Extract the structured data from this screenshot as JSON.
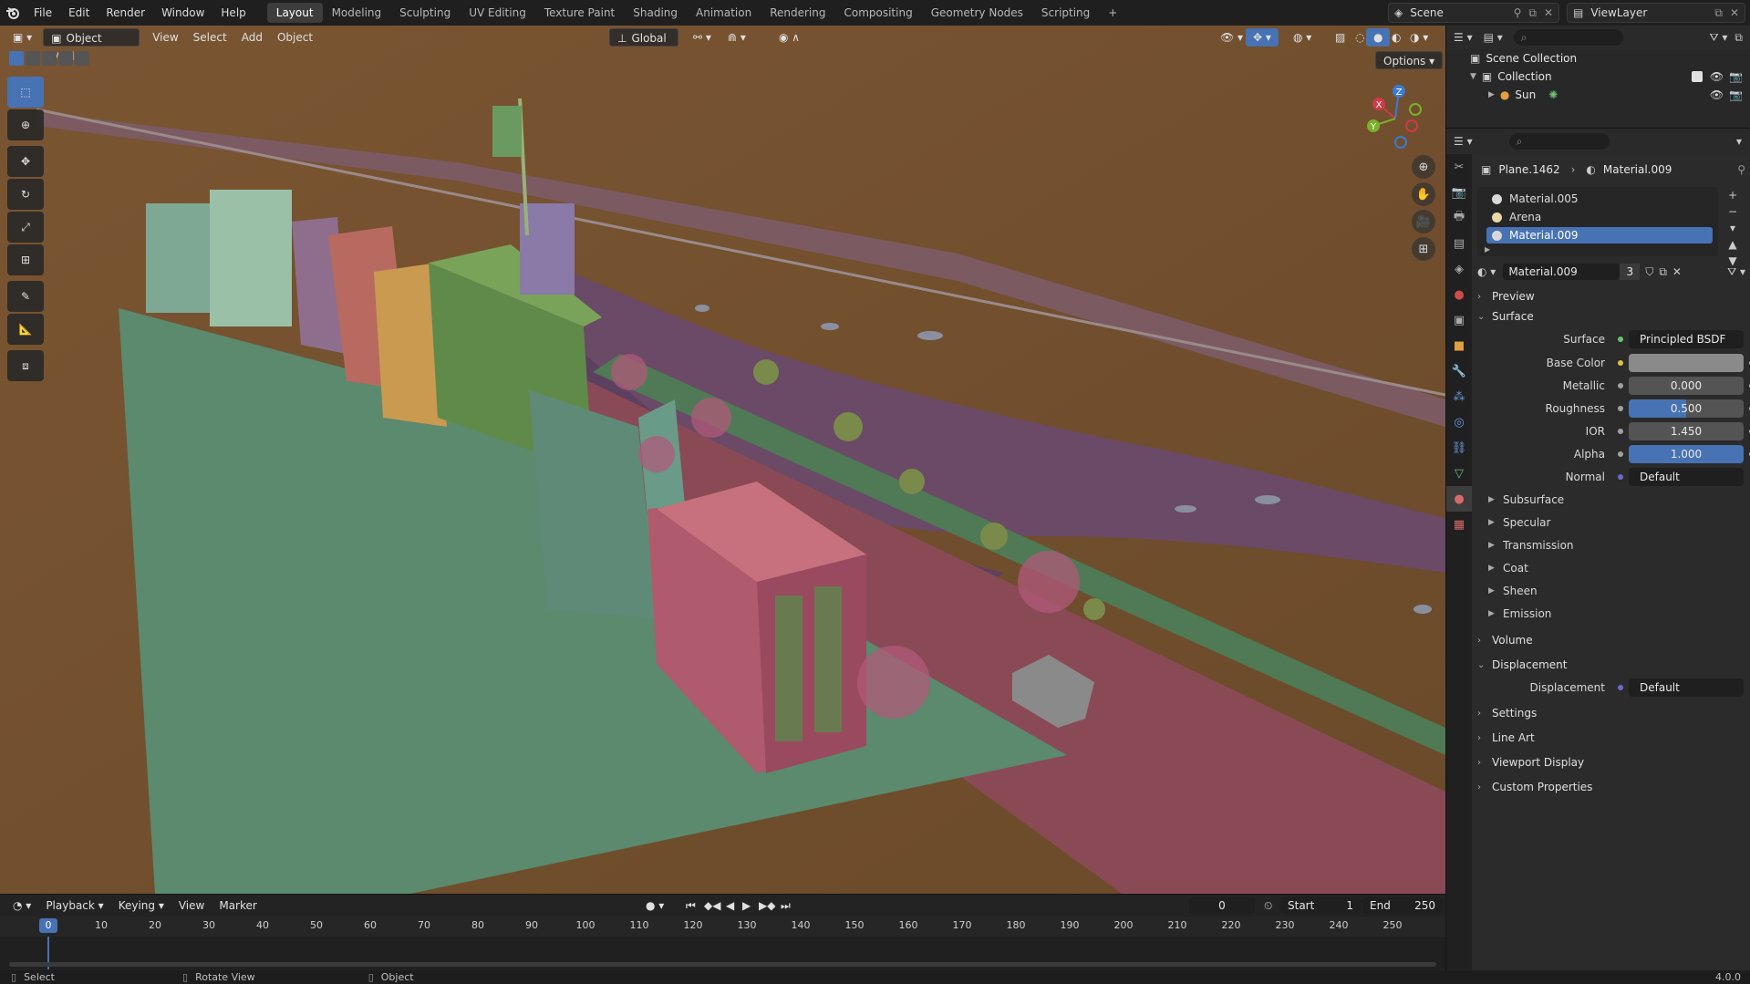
{
  "menubar": {
    "items": [
      "File",
      "Edit",
      "Render",
      "Window",
      "Help"
    ],
    "workspaces": [
      "Layout",
      "Modeling",
      "Sculpting",
      "UV Editing",
      "Texture Paint",
      "Shading",
      "Animation",
      "Rendering",
      "Compositing",
      "Geometry Nodes",
      "Scripting"
    ],
    "active_workspace": "Layout",
    "add_tab": "+",
    "scene": "Scene",
    "view_layer": "ViewLayer"
  },
  "viewport": {
    "mode": "Object Mode",
    "menus": [
      "View",
      "Select",
      "Add",
      "Object"
    ],
    "transform_orientation": "Global",
    "options_label": "Options",
    "gizmo": {
      "x": "X",
      "y": "Y",
      "z": "Z"
    }
  },
  "timeline": {
    "menus": [
      "Playback",
      "Keying",
      "View",
      "Marker"
    ],
    "current_frame": "0",
    "start_label": "Start",
    "start": "1",
    "end_label": "End",
    "end": "250",
    "ticks": [
      "10",
      "20",
      "30",
      "40",
      "50",
      "60",
      "70",
      "80",
      "90",
      "100",
      "110",
      "120",
      "130",
      "140",
      "150",
      "160",
      "170",
      "180",
      "190",
      "200",
      "210",
      "220",
      "230",
      "240",
      "250"
    ],
    "playhead_label": "0"
  },
  "statusbar": {
    "select": "Select",
    "rotate": "Rotate View",
    "object": "Object",
    "version": "4.0.0"
  },
  "outliner": {
    "scene_collection": "Scene Collection",
    "collection": "Collection",
    "sun": "Sun"
  },
  "properties": {
    "object": "Plane.1462",
    "material": "Material.009",
    "slots": [
      "Material.005",
      "Arena",
      "Material.009"
    ],
    "material_users": "3",
    "sections": {
      "preview": "Preview",
      "surface": "Surface",
      "volume": "Volume",
      "displacement": "Displacement",
      "settings": "Settings",
      "line_art": "Line Art",
      "viewport_display": "Viewport Display",
      "custom_properties": "Custom Properties"
    },
    "surface_label": "Surface",
    "surface_value": "Principled BSDF",
    "base_color_label": "Base Color",
    "metallic_label": "Metallic",
    "metallic": "0.000",
    "roughness_label": "Roughness",
    "roughness": "0.500",
    "ior_label": "IOR",
    "ior": "1.450",
    "alpha_label": "Alpha",
    "alpha": "1.000",
    "normal_label": "Normal",
    "normal": "Default",
    "subpanels": [
      "Subsurface",
      "Specular",
      "Transmission",
      "Coat",
      "Sheen",
      "Emission"
    ],
    "displacement_label": "Displacement",
    "displacement_value": "Default"
  },
  "colors": {
    "accent": "#4772b3",
    "ground": "#6b4c2c",
    "plaza": "#5b8a6e",
    "road": "#8a4a55",
    "water": "#6a4a66"
  }
}
